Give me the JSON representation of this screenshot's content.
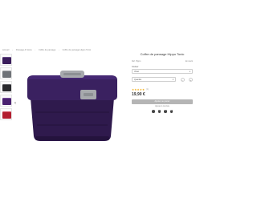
{
  "breadcrumb": [
    "Accueil",
    "Pansage & Soins",
    "Coffre de pansage",
    "Coffre de pansage Hippo Tonic"
  ],
  "breadcrumb_sep": "›",
  "thumbnails": [
    {
      "label": "Coffre violet",
      "color": "#3b1e5c",
      "lid": "#4a2a70"
    },
    {
      "label": "Coffre gris",
      "color": "#6f7378",
      "lid": "#8a8d91"
    },
    {
      "label": "Coffre noir",
      "color": "#2a2a2e",
      "lid": "#3a3a3f"
    },
    {
      "label": "Coffre violet 2",
      "color": "#4a2170",
      "lid": "#5a2d86"
    },
    {
      "label": "Coffre rouge",
      "color": "#b21e2f",
      "lid": "#c72c3d"
    }
  ],
  "product": {
    "title": "Coffre de pansage Hippo Tonic",
    "ref_label": "Réf. Hippo",
    "stock_label": "En stock",
    "color_label": "Couleur",
    "color_value": "Violet",
    "size_label": "Quantité",
    "size_value": "1",
    "rating_stars": "★★★★★",
    "review_count": "(1)",
    "price": "19,90 €",
    "add_to_cart": "Ajouter au panier",
    "wishlist": "Ajouter à ma liste",
    "share_icons": [
      "f",
      "t",
      "p",
      "m"
    ],
    "body_color": "#2f1a4d",
    "lid_color": "#3a2160",
    "accent_grey": "#a7a9ad"
  },
  "nav": {
    "prev": "‹",
    "next": "›"
  }
}
